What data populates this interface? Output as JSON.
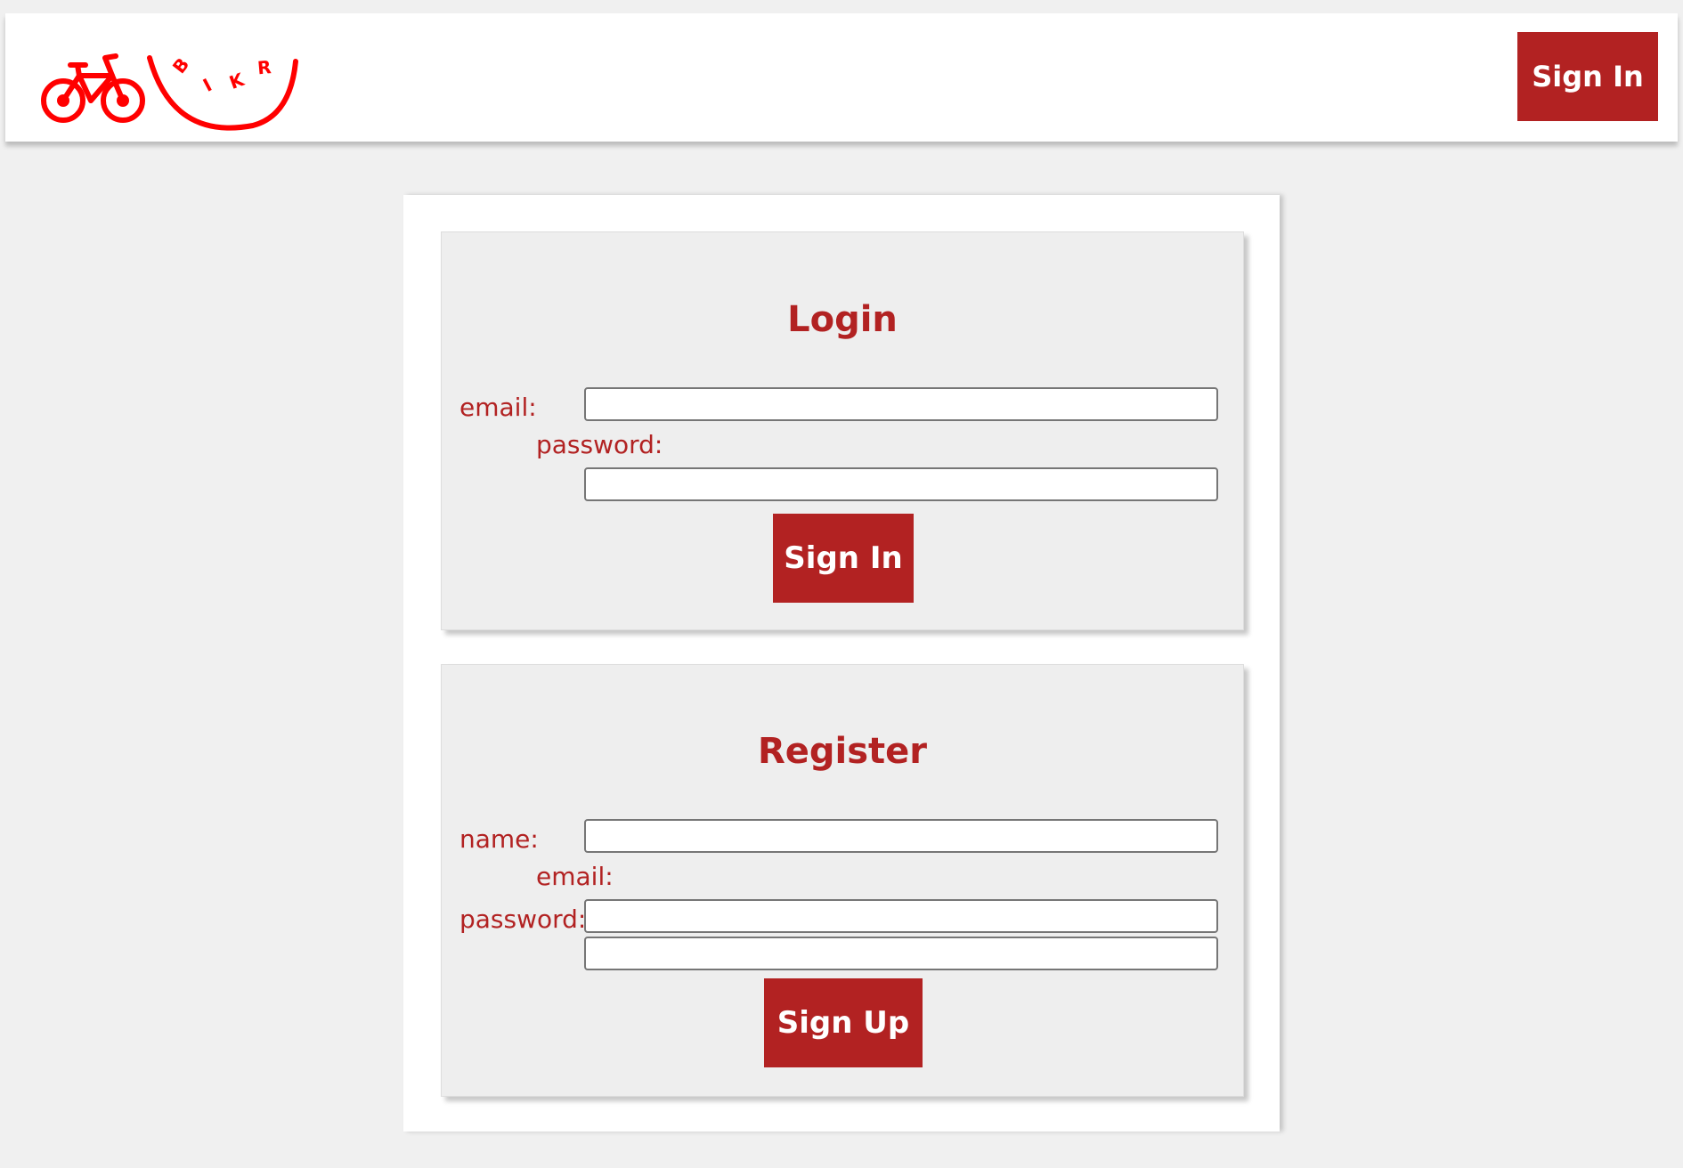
{
  "header": {
    "logo": {
      "icon": "bicycle-icon",
      "text": "BIKR",
      "color": "#ff0000"
    },
    "signin_label": "Sign In"
  },
  "login": {
    "title": "Login",
    "email_label": "email:",
    "password_label": "password:",
    "email_value": "",
    "password_value": "",
    "submit_label": "Sign In"
  },
  "register": {
    "title": "Register",
    "name_label": "name:",
    "email_label": "email:",
    "password_label": "password:",
    "name_value": "",
    "email_value": "",
    "password_value": "",
    "submit_label": "Sign Up"
  },
  "colors": {
    "accent": "#b22222",
    "logo": "#ff0000",
    "page_background": "#f0f0f0",
    "panel_background": "#eeeeee"
  }
}
